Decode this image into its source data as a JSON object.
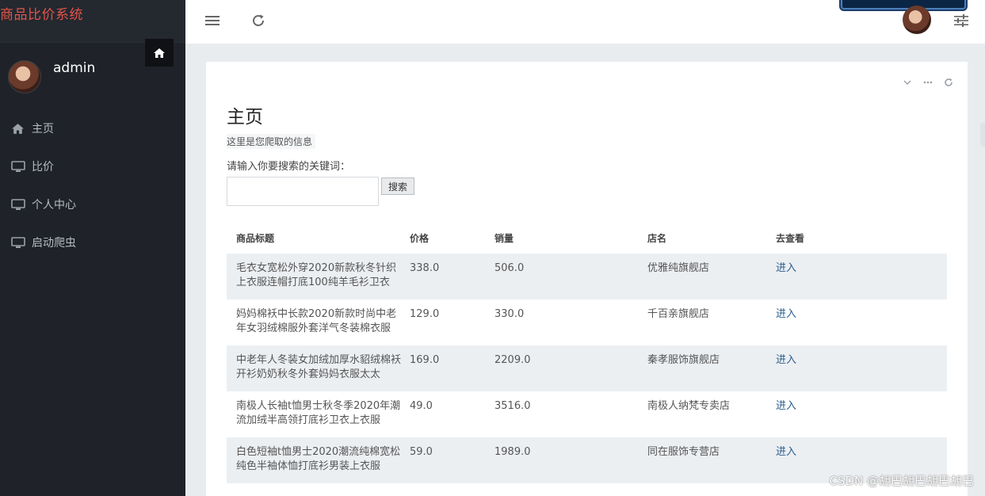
{
  "app": {
    "title": "商品比价系统"
  },
  "user": {
    "name": "admin"
  },
  "sidebar": {
    "items": [
      {
        "label": "主页",
        "icon": "home-icon"
      },
      {
        "label": "比价",
        "icon": "monitor-icon"
      },
      {
        "label": "个人中心",
        "icon": "monitor-icon"
      },
      {
        "label": "启动爬虫",
        "icon": "monitor-icon"
      }
    ]
  },
  "page": {
    "title": "主页",
    "info": "这里是您爬取的信息",
    "search_label": "请输入你要搜索的关键词：",
    "search_value": "",
    "search_button": "搜索"
  },
  "table": {
    "headers": [
      "商品标题",
      "价格",
      "销量",
      "店名",
      "去查看"
    ],
    "rows": [
      {
        "title": "毛衣女宽松外穿2020新款秋冬针织上衣服连帽打底100纯羊毛衫卫衣",
        "price": "338.0",
        "sales": "506.0",
        "shop": "优雅纯旗舰店",
        "action": "进入"
      },
      {
        "title": "妈妈棉袄中长款2020新款时尚中老年女羽绒棉服外套洋气冬装棉衣服",
        "price": "129.0",
        "sales": "330.0",
        "shop": "千百亲旗舰店",
        "action": "进入"
      },
      {
        "title": "中老年人冬装女加绒加厚水貂绒棉袄开衫奶奶秋冬外套妈妈衣服太太",
        "price": "169.0",
        "sales": "2209.0",
        "shop": "秦孝服饰旗舰店",
        "action": "进入"
      },
      {
        "title": "南极人长袖t恤男士秋冬季2020年潮流加绒半高领打底衫卫衣上衣服",
        "price": "49.0",
        "sales": "3516.0",
        "shop": "南极人纳梵专卖店",
        "action": "进入"
      },
      {
        "title": "白色短袖t恤男士2020潮流纯棉宽松纯色半袖体恤打底衫男装上衣服",
        "price": "59.0",
        "sales": "1989.0",
        "shop": "同在服饰专营店",
        "action": "进入"
      }
    ]
  },
  "watermark": "CSDN @胡巴胡巴胡巴胡巴",
  "colors": {
    "sidebar_bg": "#1f2329",
    "brand_text": "#e0544a",
    "link": "#2a5d8f"
  }
}
